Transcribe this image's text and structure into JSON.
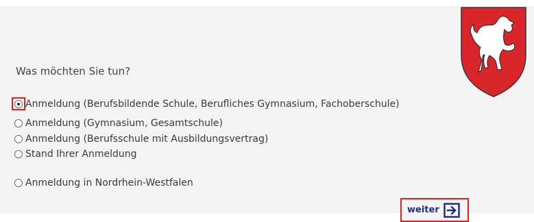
{
  "form": {
    "question": "Was möchten Sie tun?",
    "options": [
      {
        "label": "Anmeldung (Berufsbildende Schule, Berufliches Gymnasium, Fachoberschule)",
        "selected": true
      },
      {
        "label": "Anmeldung (Gymnasium, Gesamtschule)",
        "selected": false
      },
      {
        "label": "Anmeldung (Berufsschule mit Ausbildungsvertrag)",
        "selected": false
      },
      {
        "label": "Stand Ihrer Anmeldung",
        "selected": false
      },
      {
        "label": "Anmeldung in Nordrhein-Westfalen",
        "selected": false
      }
    ],
    "next_button": {
      "label": "weiter",
      "icon": "arrow-right-box-icon"
    }
  },
  "crest": {
    "icon": "lower-saxony-horse-crest",
    "colors": {
      "field": "#d8262a",
      "horse": "#ffffff"
    }
  },
  "colors": {
    "highlight": "#e0201c",
    "button_text": "#1f2f8c",
    "panel_background": "#f3f3f3"
  }
}
